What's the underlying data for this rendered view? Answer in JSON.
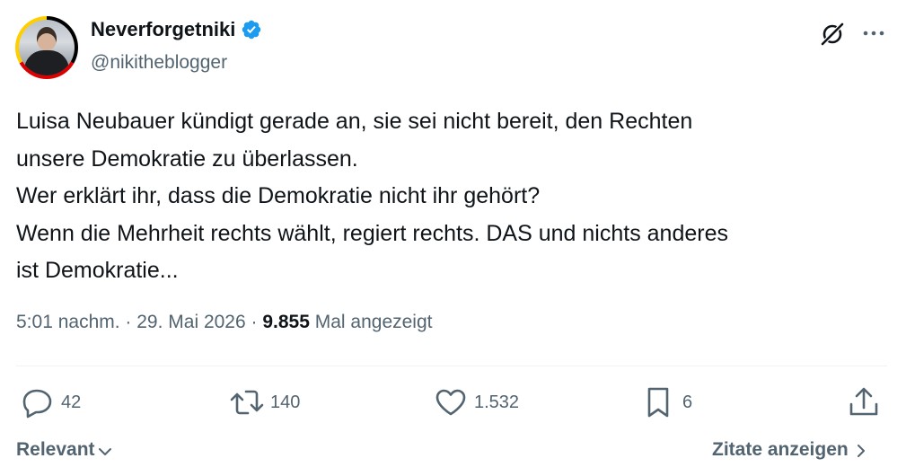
{
  "author": {
    "display_name": "Neverforgetniki",
    "handle": "@nikitheblogger",
    "verified": true,
    "verified_color": "#1d9bf0"
  },
  "header": {
    "grok_icon": "grok-icon",
    "more_icon": "more-horizontal-icon"
  },
  "tweet": {
    "lines": [
      "Luisa Neubauer kündigt gerade an, sie sei nicht bereit, den Rechten",
      "unsere Demokratie zu überlassen.",
      "Wer erklärt ihr, dass die Demokratie nicht ihr gehört?",
      "Wenn die Mehrheit rechts wählt, regiert rechts. DAS und nichts anderes",
      "ist Demokratie..."
    ]
  },
  "meta": {
    "time": "5:01 nachm.",
    "separator": " · ",
    "date": "29. Mai 2026",
    "separator2": " · ",
    "views_count": "9.855",
    "views_label": " Mal angezeigt"
  },
  "actions": {
    "reply": {
      "icon": "reply-icon",
      "count": "42"
    },
    "retweet": {
      "icon": "retweet-icon",
      "count": "140"
    },
    "like": {
      "icon": "heart-icon",
      "count": "1.532"
    },
    "bookmark": {
      "icon": "bookmark-icon",
      "count": "6"
    },
    "share": {
      "icon": "share-icon"
    }
  },
  "footer": {
    "sort_label": "Relevant",
    "quotes_label": "Zitate anzeigen"
  },
  "colors": {
    "text_primary": "#0f1419",
    "text_secondary": "#536471",
    "divider": "#eff3f4",
    "accent": "#1d9bf0"
  }
}
